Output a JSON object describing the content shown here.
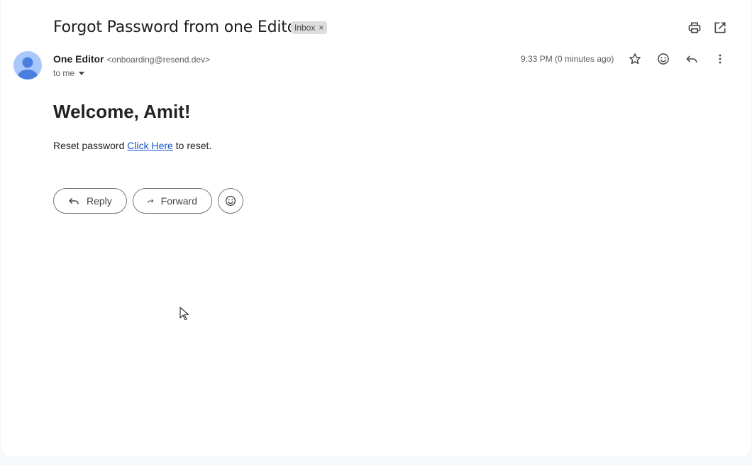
{
  "email": {
    "subject": "Forgot Password from one Editor",
    "label": "Inbox",
    "label_remove": "×",
    "sender_name": "One Editor",
    "sender_email": "<onboarding@resend.dev>",
    "recipient": "to me",
    "timestamp": "9:33 PM (0 minutes ago)"
  },
  "body": {
    "heading": "Welcome, Amit!",
    "text_before": "Reset password",
    "link_text": "Click Here",
    "text_after": "to reset."
  },
  "actions": {
    "reply_label": "Reply",
    "forward_label": "Forward"
  },
  "icons": {
    "print": "print-icon",
    "open_new_window": "open-in-new-window-icon",
    "star": "star-icon",
    "emoji": "emoji-icon",
    "reply": "reply-icon",
    "more": "more-vert-icon"
  },
  "colors": {
    "link": "#1155cc",
    "avatar_bg": "#a8c7fa",
    "avatar_fg": "#4a7fe0",
    "background": "#f6f8fc"
  }
}
